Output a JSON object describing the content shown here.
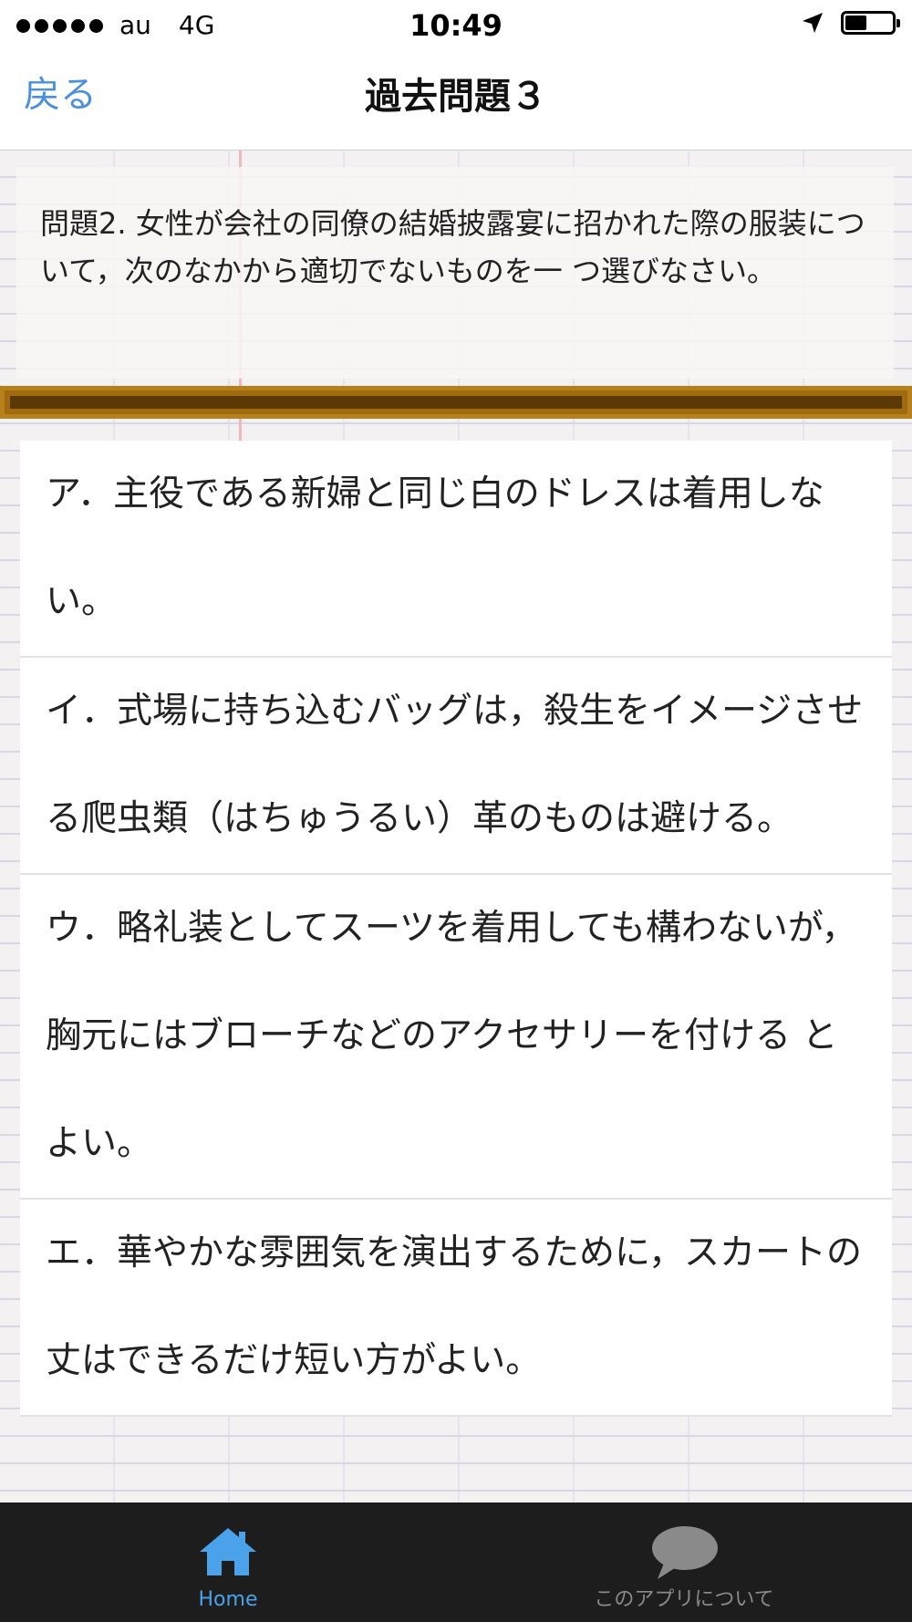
{
  "status_bar": {
    "carrier": "au",
    "network": "4G",
    "time": "10:49",
    "battery_level": 0.45
  },
  "nav": {
    "back_label": "戻る",
    "title": "過去問題３"
  },
  "question": {
    "text": "問題2. 女性が会社の同僚の結婚披露宴に招かれた際の服装について，次のなかから適切でないものを一 つ選びなさい。"
  },
  "choices": [
    {
      "text": "ア．主役である新婦と同じ白のドレスは着用しない。"
    },
    {
      "text": "イ．式場に持ち込むバッグは，殺生をイメージさせる爬虫類（はちゅうるい）革のものは避ける。"
    },
    {
      "text": "ウ．略礼装としてスーツを着用しても構わないが，胸元にはブローチなどのアクセサリーを付ける とよい。"
    },
    {
      "text": "エ．華やかな雰囲気を演出するために，スカートの丈はできるだけ短い方がよい。"
    }
  ],
  "tab_bar": {
    "home_label": "Home",
    "about_label": "このアプリについて"
  },
  "colors": {
    "accent": "#4a90e2",
    "tab_active": "#4aa3ea",
    "tab_inactive": "#8a8a8a",
    "tab_bar_bg": "#1d1d1d",
    "wood": "#a06a0e"
  }
}
